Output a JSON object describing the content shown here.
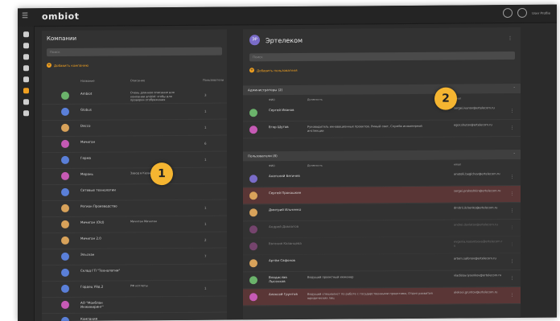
{
  "app": {
    "logo": "ombiot",
    "user_text": "User Profile"
  },
  "sidebar": {
    "items": [
      "grid",
      "location",
      "world",
      "bolt",
      "user",
      "users",
      "alert",
      "profile"
    ]
  },
  "left": {
    "title": "Компании",
    "search_placeholder": "Поиск",
    "add_label": "Добавить компанию",
    "headers": {
      "name": "Название",
      "desc": "Описание",
      "count": "Пользователи"
    },
    "rows": [
      {
        "name": "Ambiot",
        "desc": "Очень длинное описание для компании ambiot чтобы для проверки отображения",
        "count": "3",
        "color": "#6bb36b"
      },
      {
        "name": "Globus",
        "desc": "",
        "count": "1",
        "color": "#5a7fd8"
      },
      {
        "name": "Decco",
        "desc": "",
        "count": "1",
        "color": "#d8a25a"
      },
      {
        "name": "Мичиган",
        "desc": "",
        "count": "6",
        "color": "#c65ab5"
      },
      {
        "name": "Герма",
        "desc": "",
        "count": "1",
        "color": "#5a7fd8"
      },
      {
        "name": "Мерань",
        "desc": "Завод в Казани",
        "count": "",
        "color": "#c65ab5"
      },
      {
        "name": "Сетевые технологии",
        "desc": "",
        "count": "",
        "color": "#5a7fd8"
      },
      {
        "name": "Регион Производство",
        "desc": "",
        "count": "1",
        "color": "#d8a25a"
      },
      {
        "name": "Мичиган (Old)",
        "desc": "Мичиган Мичиган",
        "count": "1",
        "color": "#d8a25a"
      },
      {
        "name": "Мичиган 2.0",
        "desc": "",
        "count": "2",
        "color": "#d8a25a"
      },
      {
        "name": "Эльскан",
        "desc": "",
        "count": "7",
        "color": "#5a7fd8"
      },
      {
        "name": "Склад ГП \"Технологии\"",
        "desc": "",
        "count": "",
        "color": "#5a7fd8"
      },
      {
        "name": "Гордец Уйд.2",
        "desc": "РФ котлеты",
        "count": "1",
        "color": "#5a7fd8"
      },
      {
        "name": "АО \"Монблан Инжиниринг\"",
        "desc": "",
        "count": "",
        "color": "#c65ab5"
      },
      {
        "name": "Компания",
        "desc": "",
        "count": "",
        "color": "#5a7fd8"
      }
    ]
  },
  "right": {
    "title": "Эртелеком",
    "avatar_text": "ЭР",
    "search_placeholder": "Поиск",
    "add_label": "Добавить пользователя",
    "admins_label": "Администраторы (2)",
    "users_label": "Пользователи (8)",
    "headers": {
      "name": "ФИО",
      "pos": "Должность",
      "email": "email"
    },
    "admins": [
      {
        "name": "Сергей Иванов",
        "pos": "",
        "email": "sergei.ivanov@ertelecom.ru",
        "color": "#6bb36b",
        "state": ""
      },
      {
        "name": "Егор Шутов",
        "pos": "Руководитель инновационных проектов, Умный свет, Служба инженерной инспекции",
        "email": "egor.shutov@ertelecom.ru",
        "color": "#c65ab5",
        "state": ""
      }
    ],
    "users": [
      {
        "name": "Анатолий Бегичев",
        "pos": "",
        "email": "anatolii.begichev@ertelecom.ru",
        "color": "#7a6cc8",
        "state": ""
      },
      {
        "name": "Сергей Прокошкин",
        "pos": "",
        "email": "sergei.prokoshkin@ertelecom.ru",
        "color": "#d8a25a",
        "state": "red"
      },
      {
        "name": "Дмитрий Ильченко",
        "pos": "",
        "email": "dmitrii.ilchenko@ertelecom.ru",
        "color": "#d8a25a",
        "state": ""
      },
      {
        "name": "Андрей Довлатов",
        "pos": "",
        "email": "andrei.dovlatov@ertelecom.ru",
        "color": "#c65ab5",
        "state": "dim"
      },
      {
        "name": "Евгения Казанцева",
        "pos": "",
        "email": "evgenia.kazantseva@ertelecom.ru",
        "color": "#c65ab5",
        "state": "dim"
      },
      {
        "name": "Артём Сафонов",
        "pos": "",
        "email": "artem.safonov@ertelecom.ru",
        "color": "#d8a25a",
        "state": ""
      },
      {
        "name": "Владислав Лысенков",
        "pos": "Ведущий проектный инженер",
        "email": "vladislav.lysenkov@ertelecom.ru",
        "color": "#6bb36b",
        "state": ""
      },
      {
        "name": "Алексей Грунтов",
        "pos": "Ведущий специалист по работе с государственными проектами, Отдел развития юридических лиц",
        "email": "aleksei.gruntov@ertelecom.ru",
        "color": "#c65ab5",
        "state": "red"
      }
    ]
  },
  "callouts": [
    "1",
    "2"
  ]
}
